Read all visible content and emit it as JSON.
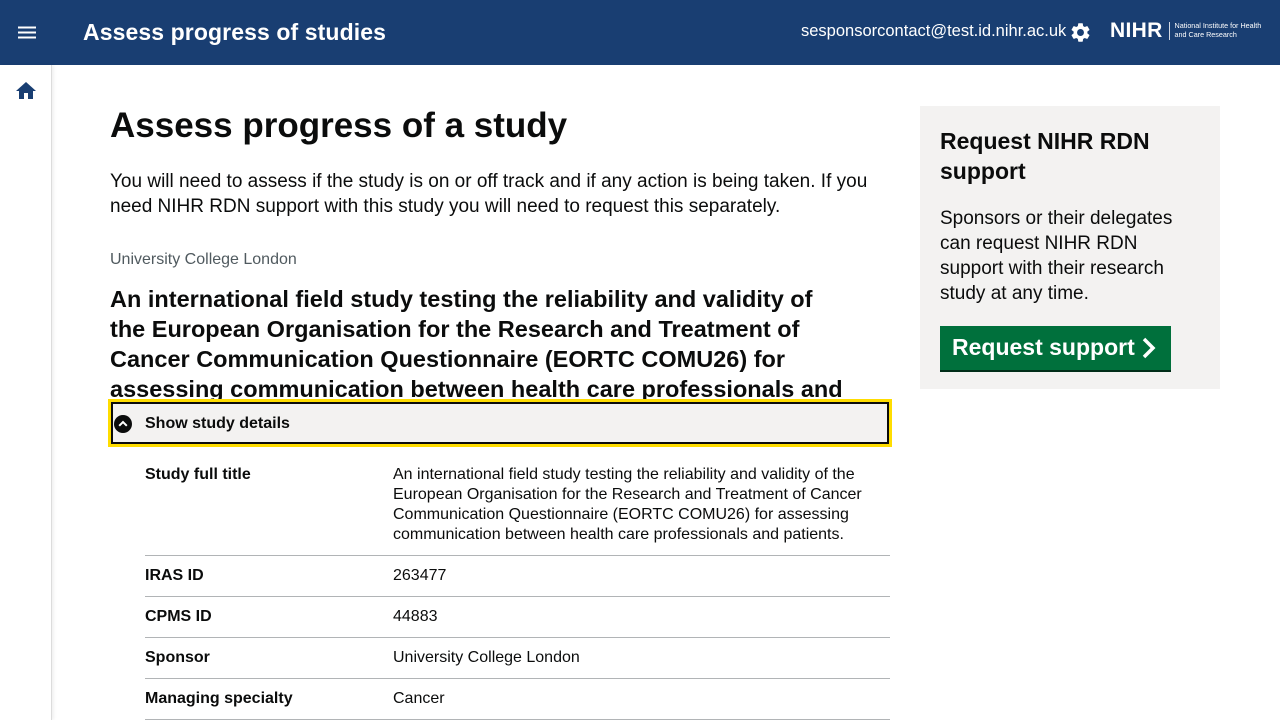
{
  "header": {
    "app_title": "Assess progress of studies",
    "user_email": "sesponsorcontact@test.id.nihr.ac.uk",
    "logo_word": "NIHR",
    "logo_subtitle": "National Institute for Health and Care Research"
  },
  "main": {
    "heading": "Assess progress of a study",
    "intro": "You will need to assess if the study is on or off track and if any action is being taken. If you need NIHR RDN support with this study you will need to request this separately.",
    "organisation": "University College London",
    "study_title": "An international field study testing the reliability and validity of the European Organisation for the Research and Treatment of Cancer Communication Questionnaire (EORTC COMU26) for assessing communication between health care professionals and patients.",
    "details_toggle_label": "Show study details",
    "details": [
      {
        "key": "Study full title",
        "value": "An international field study testing the reliability and validity of the European Organisation for the Research and Treatment of Cancer Communication Questionnaire (EORTC COMU26) for assessing communication between health care professionals and patients."
      },
      {
        "key": "IRAS ID",
        "value": "263477"
      },
      {
        "key": "CPMS ID",
        "value": "44883"
      },
      {
        "key": "Sponsor",
        "value": "University College London"
      },
      {
        "key": "Managing specialty",
        "value": "Cancer"
      }
    ]
  },
  "aside": {
    "title": "Request NIHR RDN support",
    "body": "Sponsors or their delegates can request NIHR RDN support with their research study at any time.",
    "button_label": "Request support"
  },
  "colors": {
    "header_bg": "#193e72",
    "focus_yellow": "#ffdd00",
    "button_green": "#00703c",
    "panel_grey": "#f3f2f1"
  }
}
